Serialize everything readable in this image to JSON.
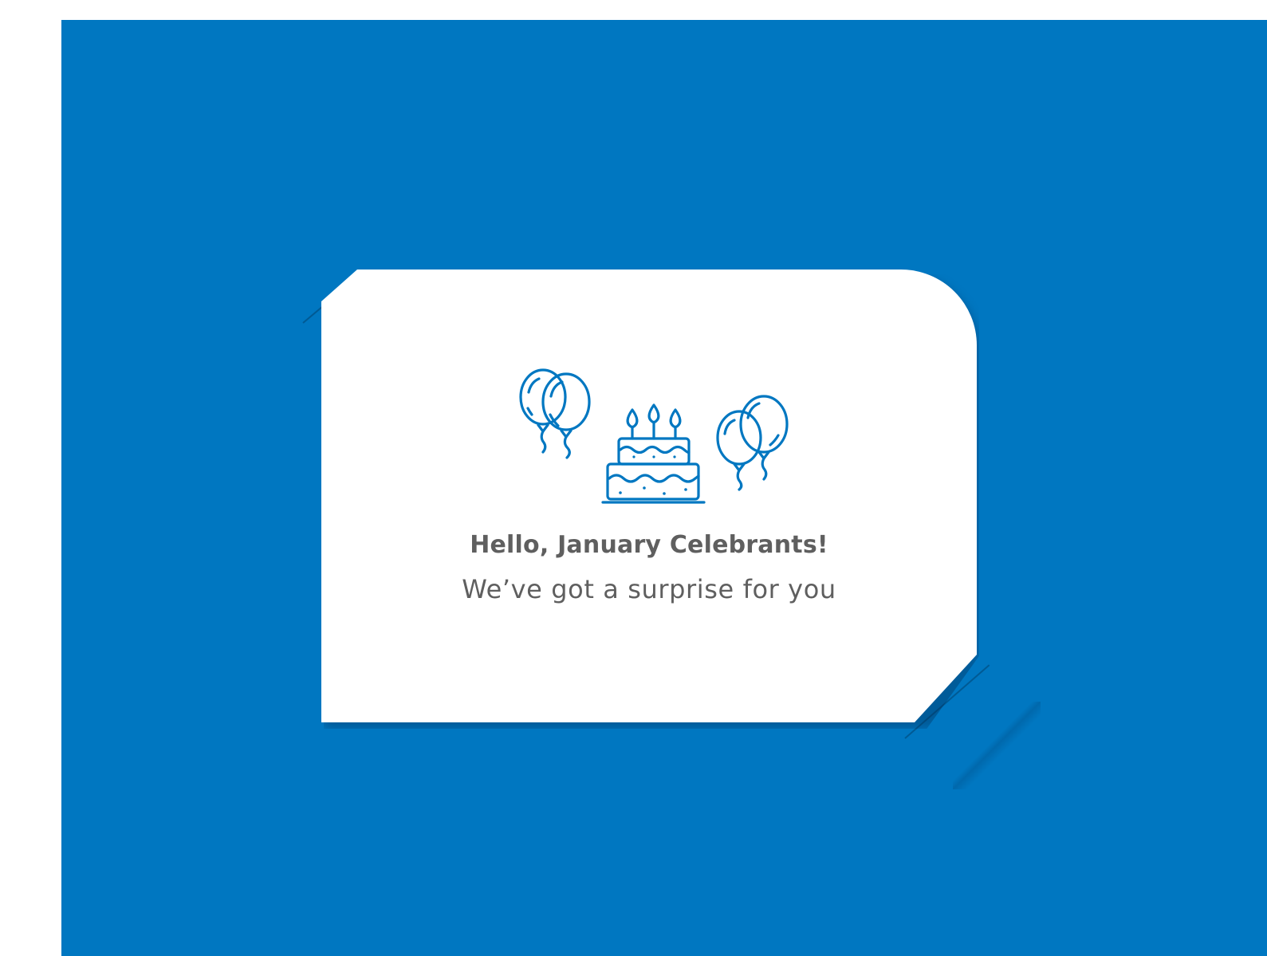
{
  "banner": {
    "title": "Hello, January Celebrants!",
    "subtitle": "We’ve got a surprise for you"
  },
  "illustration": {
    "icons": [
      "balloons-icon",
      "birthday-cake-icon",
      "balloons-icon"
    ]
  },
  "colors": {
    "background_panel": "#0077c1",
    "card": "#ffffff",
    "icon_stroke": "#0077c1",
    "text": "#5f5f5f"
  }
}
